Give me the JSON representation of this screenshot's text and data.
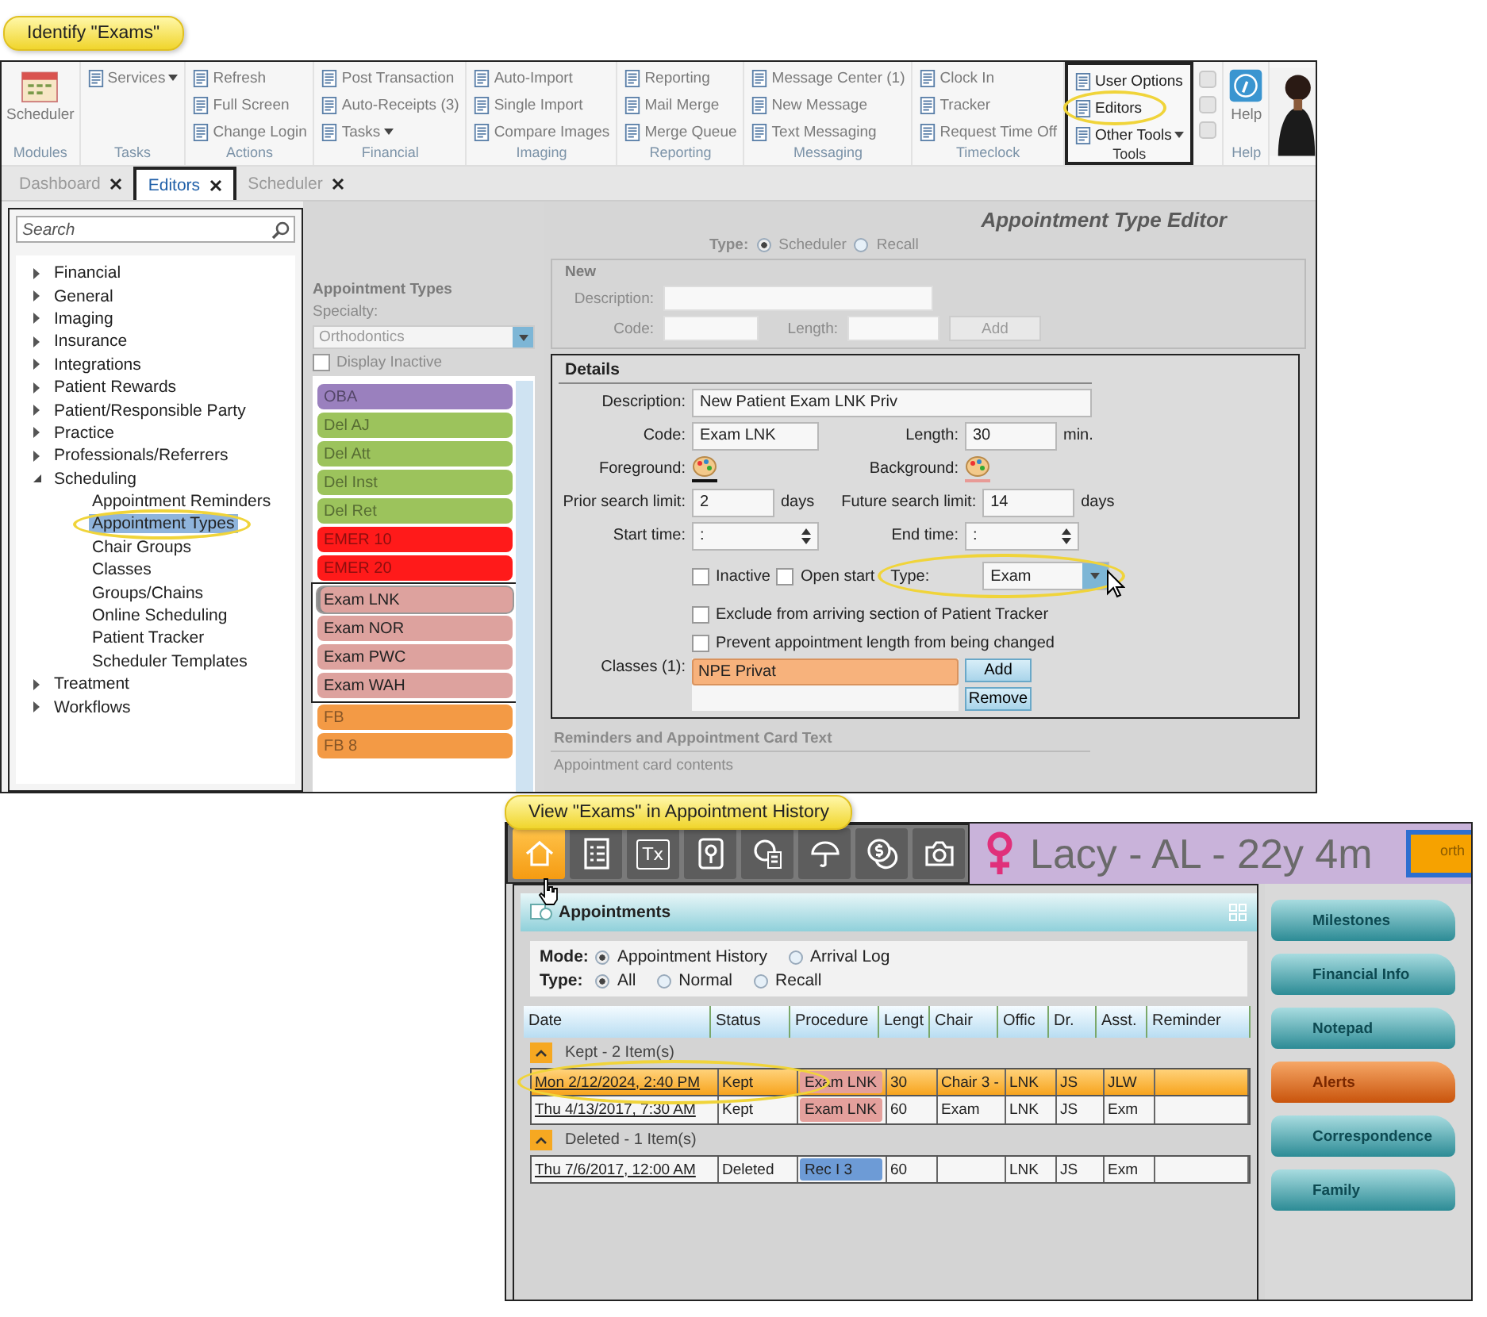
{
  "editor_screen": {
    "callout": "Identify \"Exams\"",
    "ribbon": [
      {
        "label": "Modules",
        "kind": "large",
        "items": [
          {
            "text": "Scheduler"
          }
        ]
      },
      {
        "label": "Tasks",
        "kind": "list",
        "items": [
          {
            "text": "Services",
            "dropdown": true
          }
        ]
      },
      {
        "label": "Actions",
        "kind": "list",
        "items": [
          {
            "text": "Refresh"
          },
          {
            "text": "Full Screen"
          },
          {
            "text": "Change Login"
          }
        ]
      },
      {
        "label": "Financial",
        "kind": "list",
        "items": [
          {
            "text": "Post Transaction"
          },
          {
            "text": "Auto-Receipts (3)"
          },
          {
            "text": "Tasks",
            "dropdown": true
          }
        ]
      },
      {
        "label": "Imaging",
        "kind": "list",
        "items": [
          {
            "text": "Auto-Import"
          },
          {
            "text": "Single Import"
          },
          {
            "text": "Compare Images"
          }
        ]
      },
      {
        "label": "Reporting",
        "kind": "list",
        "items": [
          {
            "text": "Reporting"
          },
          {
            "text": "Mail Merge"
          },
          {
            "text": "Merge Queue"
          }
        ]
      },
      {
        "label": "Messaging",
        "kind": "list",
        "items": [
          {
            "text": "Message Center (1)"
          },
          {
            "text": "New Message"
          },
          {
            "text": "Text Messaging"
          }
        ]
      },
      {
        "label": "Timeclock",
        "kind": "list",
        "items": [
          {
            "text": "Clock In"
          },
          {
            "text": "Tracker"
          },
          {
            "text": "Request Time Off"
          }
        ]
      },
      {
        "label": "Tools",
        "kind": "list",
        "framed": true,
        "items": [
          {
            "text": "User Options"
          },
          {
            "text": "Editors",
            "circled": true
          },
          {
            "text": "Other Tools",
            "dropdown": true
          }
        ]
      },
      {
        "kind": "icons"
      },
      {
        "label": "Help",
        "kind": "large",
        "items": [
          {
            "text": "Help"
          }
        ]
      }
    ],
    "tabs": [
      {
        "label": "Dashboard",
        "selected": false
      },
      {
        "label": "Editors",
        "selected": true
      },
      {
        "label": "Scheduler",
        "selected": false
      }
    ],
    "search": {
      "placeholder": "Search"
    },
    "tree": [
      {
        "label": "Financial",
        "expanded": false,
        "selected": false
      },
      {
        "label": "General",
        "expanded": false,
        "selected": false
      },
      {
        "label": "Imaging",
        "expanded": false,
        "selected": false
      },
      {
        "label": "Insurance",
        "expanded": false,
        "selected": false
      },
      {
        "label": "Integrations",
        "expanded": false,
        "selected": false
      },
      {
        "label": "Patient Rewards",
        "expanded": false,
        "selected": false
      },
      {
        "label": "Patient/Responsible Party",
        "expanded": false,
        "selected": false
      },
      {
        "label": "Practice",
        "expanded": false,
        "selected": false
      },
      {
        "label": "Professionals/Referrers",
        "expanded": false,
        "selected": false
      },
      {
        "label": "Scheduling",
        "expanded": true,
        "selected": false,
        "children": [
          {
            "label": "Appointment Reminders",
            "selected": false
          },
          {
            "label": "Appointment Types",
            "selected": true,
            "circled": true
          },
          {
            "label": "Chair Groups",
            "selected": false
          },
          {
            "label": "Classes",
            "selected": false
          },
          {
            "label": "Groups/Chains",
            "selected": false
          },
          {
            "label": "Online Scheduling",
            "selected": false
          },
          {
            "label": "Patient Tracker",
            "selected": false
          },
          {
            "label": "Scheduler Templates",
            "selected": false
          }
        ]
      },
      {
        "label": "Treatment",
        "expanded": false,
        "selected": false
      },
      {
        "label": "Workflows",
        "expanded": false,
        "selected": false
      }
    ],
    "appointment_types": {
      "title": "Appointment Types",
      "specialty_label": "Specialty:",
      "specialty": "Orthodontics",
      "display_inactive": {
        "label": "Display Inactive",
        "checked": false
      },
      "sections": [
        {
          "framed": false,
          "items": [
            {
              "text": "OBA",
              "color": "#9a80be",
              "selected": false
            },
            {
              "text": "Del AJ",
              "color": "#9cc35c",
              "selected": false
            },
            {
              "text": "Del Att",
              "color": "#9cc35c",
              "selected": false
            },
            {
              "text": "Del Inst",
              "color": "#9cc35c",
              "selected": false
            },
            {
              "text": "Del Ret",
              "color": "#9cc35c",
              "selected": false
            },
            {
              "text": "EMER 10",
              "color": "#ff1a1a",
              "selected": false
            },
            {
              "text": "EMER 20",
              "color": "#ff1a1a",
              "selected": false
            }
          ]
        },
        {
          "framed": true,
          "items": [
            {
              "text": "Exam LNK",
              "color": "#dda29e",
              "selected": true
            },
            {
              "text": "Exam NOR",
              "color": "#dda29e",
              "selected": false
            },
            {
              "text": "Exam PWC",
              "color": "#dda29e",
              "selected": false
            },
            {
              "text": "Exam WAH",
              "color": "#dda29e",
              "selected": false
            }
          ]
        },
        {
          "framed": false,
          "items": [
            {
              "text": "FB",
              "color": "#f39a45",
              "selected": false
            },
            {
              "text": "FB 8",
              "color": "#f39a45",
              "selected": false
            }
          ]
        }
      ]
    },
    "editor": {
      "title": "Appointment Type Editor",
      "type_label": "Type:",
      "type_options": [
        {
          "label": "Scheduler",
          "selected": true
        },
        {
          "label": "Recall",
          "selected": false
        }
      ],
      "new_group": {
        "title": "New",
        "description_label": "Description:",
        "code_label": "Code:",
        "length_label": "Length:",
        "add_button": "Add"
      },
      "details": {
        "title": "Details",
        "description": {
          "label": "Description:",
          "value": "New Patient Exam LNK Priv"
        },
        "code": {
          "label": "Code:",
          "value": "Exam LNK"
        },
        "length": {
          "label": "Length:",
          "value": "30",
          "unit": "min."
        },
        "foreground": {
          "label": "Foreground:",
          "color": "#111111"
        },
        "background": {
          "label": "Background:",
          "color": "#e89a96"
        },
        "prior_search": {
          "label": "Prior search limit:",
          "value": "2",
          "unit": "days"
        },
        "future_search": {
          "label": "Future search limit:",
          "value": "14",
          "unit": "days"
        },
        "start_time": {
          "label": "Start time:",
          "value": ":"
        },
        "end_time": {
          "label": "End time:",
          "value": ":"
        },
        "inactive": {
          "label": "Inactive",
          "checked": false
        },
        "open_start": {
          "label": "Open start",
          "checked": false
        },
        "type": {
          "label": "Type:",
          "value": "Exam",
          "circled": true
        },
        "exclude": {
          "label": "Exclude from arriving section of Patient Tracker",
          "checked": false
        },
        "prevent": {
          "label": "Prevent appointment length from being changed",
          "checked": false
        },
        "classes": {
          "label": "Classes (1):",
          "items": [
            {
              "text": "NPE Privat",
              "selected": true
            }
          ],
          "add_button": "Add",
          "remove_button": "Remove"
        }
      },
      "reminders": {
        "title": "Reminders and Appointment Card Text",
        "card_label": "Appointment card contents"
      }
    }
  },
  "history_screen": {
    "callout": "View \"Exams\" in Appointment History",
    "nav_icons": [
      {
        "kind": "home",
        "selected": true
      },
      {
        "kind": "checklist",
        "selected": false
      },
      {
        "kind": "text",
        "label": "Tx",
        "selected": false
      },
      {
        "kind": "pin",
        "selected": false
      },
      {
        "kind": "globe",
        "selected": false
      },
      {
        "kind": "umbrella",
        "selected": false
      },
      {
        "kind": "dollar",
        "selected": false
      },
      {
        "kind": "camera",
        "selected": false
      }
    ],
    "patient": {
      "name": "Lacy - AL - 22y 4m",
      "chip": "orth"
    },
    "appointments": {
      "title": "Appointments",
      "mode_label": "Mode:",
      "modes": [
        {
          "label": "Appointment History",
          "selected": true
        },
        {
          "label": "Arrival Log",
          "selected": false
        }
      ],
      "type_label": "Type:",
      "types": [
        {
          "label": "All",
          "selected": true
        },
        {
          "label": "Normal",
          "selected": false
        },
        {
          "label": "Recall",
          "selected": false
        }
      ],
      "columns": [
        "Date",
        "Status",
        "Procedure",
        "Lengt",
        "Chair",
        "Offic",
        "Dr.",
        "Asst.",
        "Reminder"
      ],
      "groups": [
        {
          "title": "Kept - 2 Item(s)",
          "expanded": true,
          "rows": [
            {
              "selected": true,
              "circled": true,
              "date": "Mon 2/12/2024, 2:40 PM",
              "status": "Kept",
              "procedure": {
                "text": "Exam LNK",
                "color": "#e4a09c"
              },
              "length": "30",
              "chair": "Chair 3 -",
              "office": "LNK",
              "dr": "JS",
              "asst": "JLW"
            },
            {
              "selected": false,
              "date": "Thu 4/13/2017, 7:30 AM",
              "status": "Kept",
              "procedure": {
                "text": "Exam LNK",
                "color": "#e4a09c"
              },
              "length": "60",
              "chair": "Exam",
              "office": "LNK",
              "dr": "JS",
              "asst": "Exm"
            }
          ]
        },
        {
          "title": "Deleted - 1 Item(s)",
          "expanded": true,
          "rows": [
            {
              "selected": false,
              "date": "Thu 7/6/2017, 12:00 AM",
              "status": "Deleted",
              "procedure": {
                "text": "Rec I 3",
                "color": "#6d9bd6"
              },
              "length": "60",
              "office": "LNK",
              "dr": "JS",
              "asst": "Exm"
            }
          ]
        }
      ]
    },
    "sidebar": [
      {
        "label": "Milestones",
        "kind": "normal"
      },
      {
        "label": "Financial Info",
        "kind": "normal"
      },
      {
        "label": "Notepad",
        "kind": "normal"
      },
      {
        "label": "Alerts",
        "kind": "alert"
      },
      {
        "label": "Correspondence",
        "kind": "normal"
      },
      {
        "label": "Family",
        "kind": "normal"
      }
    ]
  }
}
